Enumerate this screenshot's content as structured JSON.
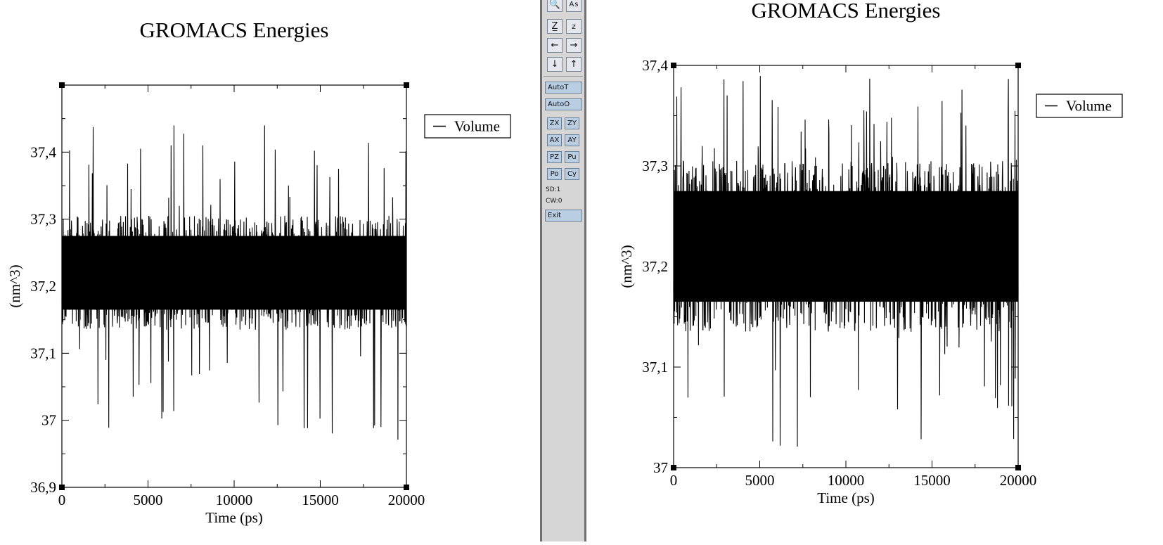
{
  "toolbar": {
    "icon_buttons": [
      "search-icon",
      "text-icon",
      "zoom-in-icon",
      "zoom-out-icon",
      "arrow-left-icon",
      "arrow-right-icon",
      "arrow-down-icon",
      "arrow-up-icon"
    ],
    "autot_label": "AutoT",
    "autoo_label": "AutoO",
    "zx_label": "ZX",
    "zy_label": "ZY",
    "ax_label": "AX",
    "ay_label": "AY",
    "pz_label": "PZ",
    "pu_label": "Pu",
    "po_label": "Po",
    "cy_label": "Cy",
    "sd_label": "SD:1",
    "cw_label": "CW:0",
    "exit_label": "Exit"
  },
  "chart_data": [
    {
      "type": "line",
      "title": "GROMACS Energies",
      "xlabel": "Time (ps)",
      "ylabel": "(nm^3)",
      "xlim": [
        0,
        20000
      ],
      "ylim": [
        36.9,
        37.5
      ],
      "x_ticks": [
        0,
        5000,
        10000,
        15000,
        20000
      ],
      "x_tick_labels": [
        "0",
        "5000",
        "10000",
        "15000",
        "20000"
      ],
      "y_ticks": [
        36.9,
        37.0,
        37.1,
        37.2,
        37.3,
        37.4
      ],
      "y_tick_labels": [
        "36,9",
        "37",
        "37,1",
        "37,2",
        "37,3",
        "37,4"
      ],
      "legend_position": "top-right outside",
      "series": [
        {
          "name": "Volume",
          "color": "#000000",
          "mean": 37.22,
          "typical_min": 37.12,
          "typical_max": 37.32,
          "extreme_min": 36.97,
          "extreme_max": 37.44
        }
      ]
    },
    {
      "type": "line",
      "title": "GROMACS Energies",
      "xlabel": "Time (ps)",
      "ylabel": "(nm^3)",
      "xlim": [
        0,
        20000
      ],
      "ylim": [
        37.0,
        37.4
      ],
      "x_ticks": [
        0,
        5000,
        10000,
        15000,
        20000
      ],
      "x_tick_labels": [
        "0",
        "5000",
        "10000",
        "15000",
        "20000"
      ],
      "y_ticks": [
        37.0,
        37.1,
        37.2,
        37.3,
        37.4
      ],
      "y_tick_labels": [
        "37",
        "37,1",
        "37,2",
        "37,3",
        "37,4"
      ],
      "legend_position": "top-right outside",
      "series": [
        {
          "name": "Volume",
          "color": "#000000",
          "mean": 37.22,
          "typical_min": 37.12,
          "typical_max": 37.32,
          "extreme_min": 37.02,
          "extreme_max": 37.39
        }
      ]
    }
  ]
}
